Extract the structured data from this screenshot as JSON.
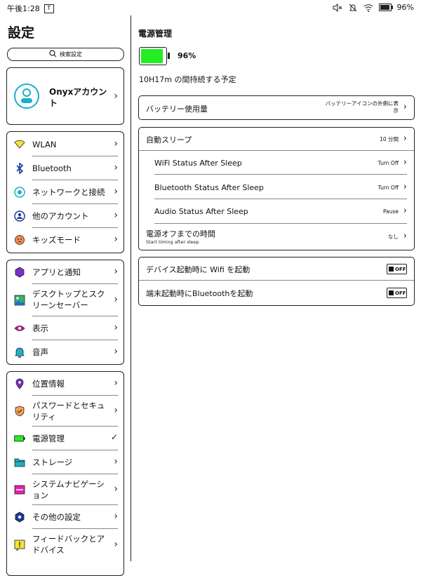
{
  "status_bar": {
    "time": "午後1:28",
    "notif_glyph": "T",
    "battery": "96%",
    "battery_fraction": 0.96,
    "icons": [
      "mute-icon",
      "bell-off-icon",
      "wifi-icon",
      "battery-icon"
    ]
  },
  "sidebar": {
    "title": "設定",
    "search_placeholder": "検索設定",
    "account": {
      "label": "Onyxアカウント",
      "icon": "user-icon"
    },
    "group1": [
      {
        "label": "WLAN",
        "icon": "wifi-icon"
      },
      {
        "label": "Bluetooth",
        "icon": "bluetooth-icon"
      },
      {
        "label": "ネットワークと接続",
        "icon": "network-icon"
      },
      {
        "label": "他のアカウント",
        "icon": "account-icon"
      },
      {
        "label": "キッズモード",
        "icon": "kids-icon"
      }
    ],
    "group2": [
      {
        "label": "アプリと通知",
        "icon": "apps-icon"
      },
      {
        "label": "デスクトップとスクリーンセーバー",
        "icon": "desktop-icon"
      },
      {
        "label": "表示",
        "icon": "eye-icon"
      },
      {
        "label": "音声",
        "icon": "bell-icon"
      }
    ],
    "group3": [
      {
        "label": "位置情報",
        "icon": "location-icon"
      },
      {
        "label": "パスワードとセキュリティ",
        "icon": "shield-icon"
      },
      {
        "label": "電源管理",
        "icon": "battery-icon",
        "selected": true
      },
      {
        "label": "ストレージ",
        "icon": "folder-icon"
      },
      {
        "label": "システムナビゲーション",
        "icon": "navigation-icon"
      },
      {
        "label": "その他の設定",
        "icon": "gear-icon"
      },
      {
        "label": "フィードバックとアドバイス",
        "icon": "feedback-icon"
      }
    ]
  },
  "main": {
    "title": "電源管理",
    "battery_percent": "96%",
    "battery_fraction": 0.96,
    "remaining": "10H17m の間持続する予定",
    "battery_usage": {
      "label": "バッテリー使用量",
      "value": "バッテリーアイコンの外側に表示"
    },
    "sleep": {
      "auto_sleep": {
        "label": "自動スリープ",
        "value": "10 分間"
      },
      "wifi": {
        "label": "WiFi Status After Sleep",
        "value": "Turn Off"
      },
      "bluetooth": {
        "label": "Bluetooth Status After Sleep",
        "value": "Turn Off"
      },
      "audio": {
        "label": "Audio Status After Sleep",
        "value": "Pause"
      },
      "power_off": {
        "label": "電源オフまでの時間",
        "sub": "Start timing after sleep",
        "value": "なし"
      }
    },
    "startup": {
      "wifi": {
        "label": "デバイス起動時に Wifi を起動",
        "state": "OFF"
      },
      "bluetooth": {
        "label": "端末起動時にBluetoothを起動",
        "state": "OFF"
      }
    }
  },
  "colors": {
    "battery_green": "#22ee22",
    "accent_cyan": "#1ab0c8",
    "wlan_yellow": "#f2e33a",
    "purple": "#8a2be2"
  }
}
